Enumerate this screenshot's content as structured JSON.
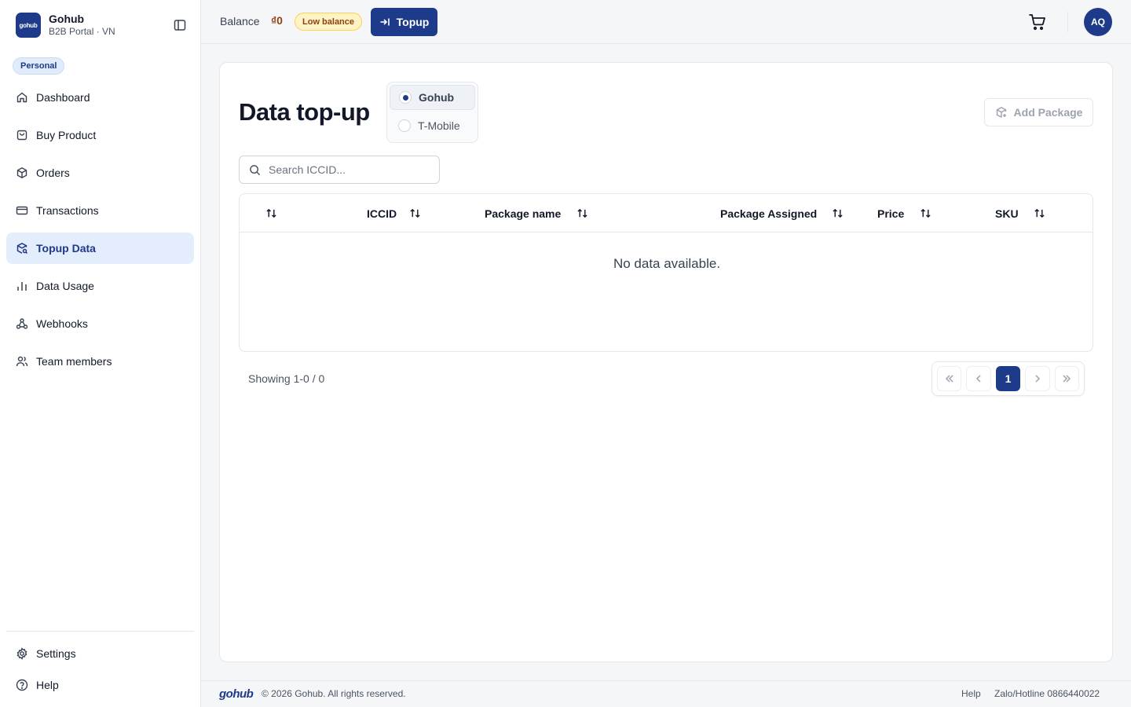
{
  "brand": {
    "logo_text": "gohub",
    "name": "Gohub",
    "subtitle": "B2B Portal · VN"
  },
  "workspace": {
    "badge": "Personal"
  },
  "sidebar": {
    "items": [
      {
        "label": "Dashboard",
        "icon": "home-icon"
      },
      {
        "label": "Buy Product",
        "icon": "shopping-bag-icon"
      },
      {
        "label": "Orders",
        "icon": "package-icon"
      },
      {
        "label": "Transactions",
        "icon": "credit-card-icon"
      },
      {
        "label": "Topup Data",
        "icon": "package-search-icon",
        "active": true
      },
      {
        "label": "Data Usage",
        "icon": "bar-chart-icon"
      },
      {
        "label": "Webhooks",
        "icon": "webhook-icon"
      },
      {
        "label": "Team members",
        "icon": "users-icon"
      }
    ],
    "bottom": [
      {
        "label": "Settings",
        "icon": "gear-icon"
      },
      {
        "label": "Help",
        "icon": "help-circle-icon"
      }
    ]
  },
  "topbar": {
    "balance_label": "Balance",
    "balance_amount": "₫0",
    "low_balance_badge": "Low balance",
    "topup_label": "Topup",
    "avatar_initials": "AQ"
  },
  "page": {
    "title": "Data top-up",
    "providers": [
      {
        "label": "Gohub",
        "selected": true
      },
      {
        "label": "T-Mobile",
        "selected": false
      }
    ],
    "add_package_label": "Add Package",
    "search_placeholder": "Search ICCID...",
    "table": {
      "columns": [
        "",
        "ICCID",
        "Package name",
        "Package Assigned",
        "Price",
        "SKU"
      ],
      "rows": [],
      "empty_message": "No data available."
    },
    "showing": "Showing 1-0 / 0",
    "pagination": {
      "current_page": "1"
    }
  },
  "footer": {
    "logo_text": "gohub",
    "copyright": "© 2026 Gohub. All rights reserved.",
    "help": "Help",
    "hotline": "Zalo/Hotline 0866440022"
  },
  "colors": {
    "primary": "#1e3a8a",
    "active_bg": "#e3edfb",
    "warning_bg": "#fef3c7",
    "warning_text": "#92400e"
  }
}
